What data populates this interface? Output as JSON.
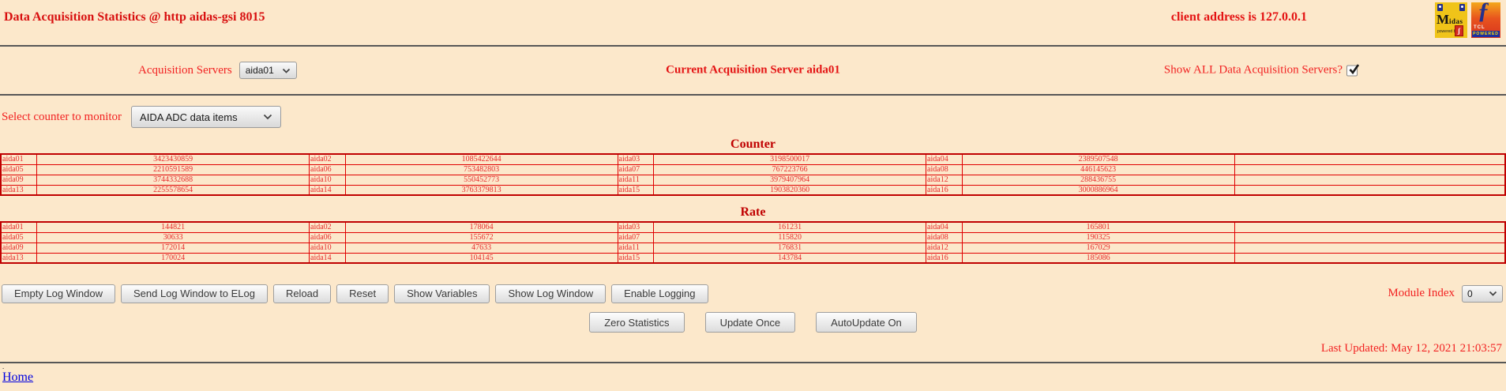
{
  "header": {
    "title": "Data Acquisition Statistics @ http aidas-gsi 8015",
    "client_address": "client address is 127.0.0.1",
    "logos": {
      "midas": {
        "m": "M",
        "rest": "idas",
        "powered": "powered by",
        "psi": "ʃ"
      },
      "tcl": {
        "feather": "ƒ",
        "name": "TCL",
        "powered": "POWERED"
      }
    }
  },
  "server_row": {
    "label": "Acquisition Servers",
    "server_select_value": "aida01",
    "current_server": "Current Acquisition Server aida01",
    "show_all_label": "Show ALL Data Acquisition Servers?",
    "show_all_checked": true
  },
  "counter_select_row": {
    "label": "Select counter to monitor",
    "select_value": "AIDA ADC data items"
  },
  "counter_section": {
    "title": "Counter",
    "rows": [
      [
        [
          "aida01",
          "3423430859"
        ],
        [
          "aida02",
          "1085422644"
        ],
        [
          "aida03",
          "3198500017"
        ],
        [
          "aida04",
          "2389507548"
        ]
      ],
      [
        [
          "aida05",
          "2210591589"
        ],
        [
          "aida06",
          "753482803"
        ],
        [
          "aida07",
          "767223766"
        ],
        [
          "aida08",
          "446145623"
        ]
      ],
      [
        [
          "aida09",
          "3744332688"
        ],
        [
          "aida10",
          "550452773"
        ],
        [
          "aida11",
          "3979407964"
        ],
        [
          "aida12",
          "288436755"
        ]
      ],
      [
        [
          "aida13",
          "2255578654"
        ],
        [
          "aida14",
          "3763379813"
        ],
        [
          "aida15",
          "1903820360"
        ],
        [
          "aida16",
          "3000886964"
        ]
      ]
    ]
  },
  "rate_section": {
    "title": "Rate",
    "rows": [
      [
        [
          "aida01",
          "144821"
        ],
        [
          "aida02",
          "178064"
        ],
        [
          "aida03",
          "161231"
        ],
        [
          "aida04",
          "165801"
        ]
      ],
      [
        [
          "aida05",
          "30633"
        ],
        [
          "aida06",
          "155672"
        ],
        [
          "aida07",
          "115820"
        ],
        [
          "aida08",
          "190325"
        ]
      ],
      [
        [
          "aida09",
          "172014"
        ],
        [
          "aida10",
          "47633"
        ],
        [
          "aida11",
          "176831"
        ],
        [
          "aida12",
          "167029"
        ]
      ],
      [
        [
          "aida13",
          "170024"
        ],
        [
          "aida14",
          "104145"
        ],
        [
          "aida15",
          "143784"
        ],
        [
          "aida16",
          "185086"
        ]
      ]
    ]
  },
  "toolbar": {
    "buttons": [
      "Empty Log Window",
      "Send Log Window to ELog",
      "Reload",
      "Reset",
      "Show Variables",
      "Show Log Window",
      "Enable Logging"
    ],
    "module_index_label": "Module Index",
    "module_index_value": "0"
  },
  "update_bar": {
    "buttons": [
      "Zero Statistics",
      "Update Once",
      "AutoUpdate On"
    ]
  },
  "footer": {
    "last_updated": "Last Updated: May 12, 2021 21:03:57",
    "dot": ".",
    "home_link": "Home"
  },
  "colors": {
    "background": "#fce8cb",
    "title_red": "#d80f0f",
    "label_red": "#f22222",
    "table_red": "#e62b2b",
    "table_border": "#c00000",
    "link_blue": "#0000e0"
  }
}
